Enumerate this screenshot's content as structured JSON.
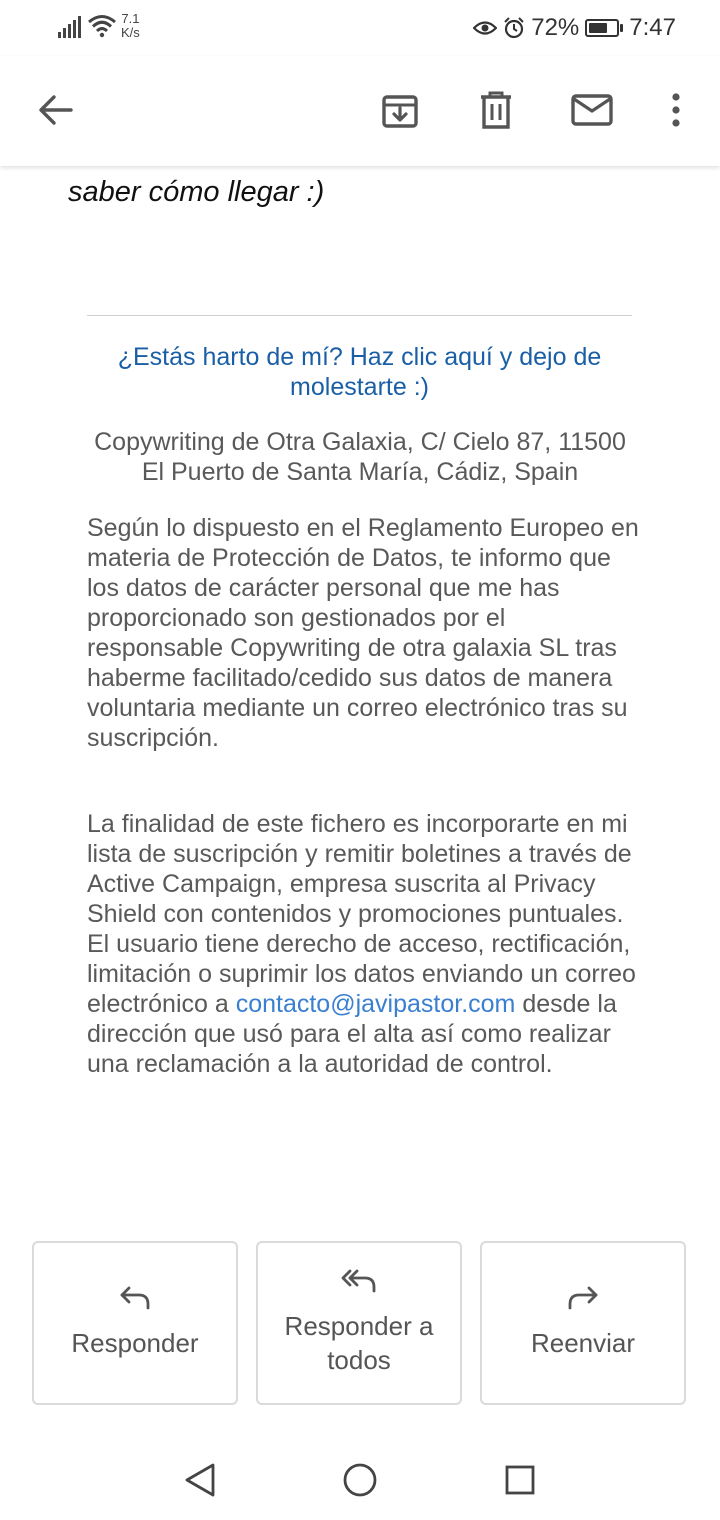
{
  "status_bar": {
    "net_speed_value": "7.1",
    "net_speed_unit": "K/s",
    "battery_percent": "72%",
    "battery_level": 0.72,
    "time": "7:47"
  },
  "email": {
    "closing_line": "saber cómo llegar :)",
    "unsubscribe_text": "¿Estás harto de mí? Haz clic aquí y dejo de molestarte :)",
    "address": "Copywriting de Otra Galaxia, C/ Cielo 87, 11500 El Puerto de Santa María, Cádiz, Spain",
    "privacy_paragraph": "Según lo dispuesto en el Reglamento Europeo en materia de Protección de Datos, te informo que los datos de carácter personal que me has proporcionado son gestionados por el responsable Copywriting de otra galaxia SL tras haberme facilitado/cedido sus datos de manera voluntaria mediante un correo electrónico tras su suscripción.",
    "purpose_before_link": "La finalidad de este fichero es incorporarte en mi lista de suscripción y remitir boletines a través de Active Campaign, empresa suscrita al Privacy Shield con contenidos y promociones puntuales. El usuario tiene derecho de acceso, rectificación, limitación o suprimir los datos enviando un correo electrónico a ",
    "contact_email": "contacto@javipastor.com",
    "purpose_after_link": " desde la dirección que usó para el alta así como realizar una reclamación a la autoridad de control."
  },
  "actions": {
    "reply": "Responder",
    "reply_all": "Responder a todos",
    "forward": "Reenviar"
  },
  "icons": {
    "back": "arrow-back-icon",
    "archive": "archive-icon",
    "delete": "trash-icon",
    "mark_unread": "mail-icon",
    "more": "more-vert-icon"
  }
}
